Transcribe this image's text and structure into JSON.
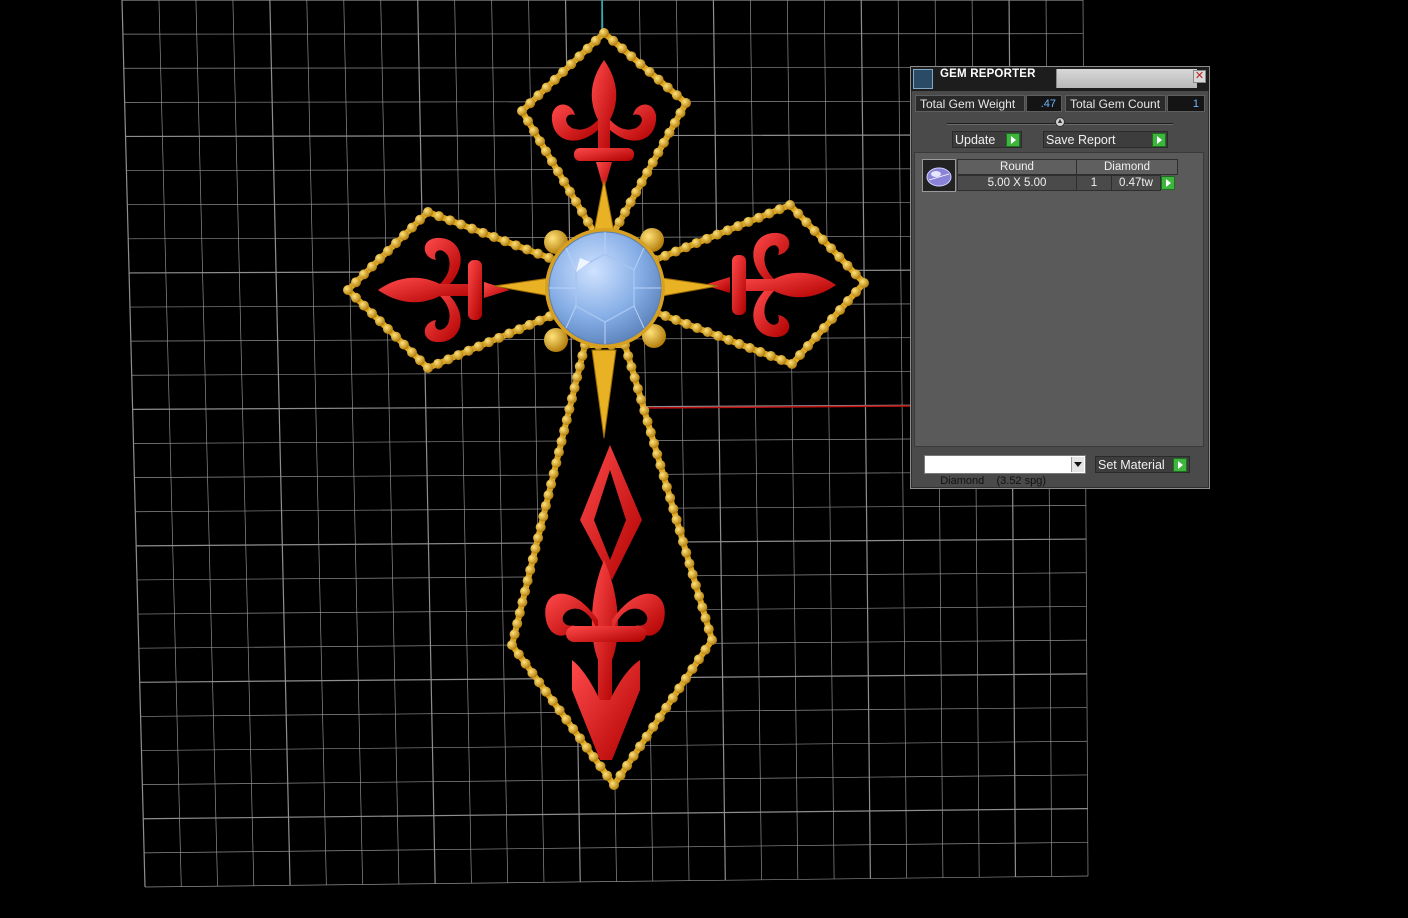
{
  "window": {
    "title": "GEM REPORTER",
    "close_glyph": "✕"
  },
  "stats": {
    "weight_label": "Total Gem Weight",
    "weight_value": ".47",
    "count_label": "Total Gem Count",
    "count_value": "1"
  },
  "actions": {
    "update_label": "Update",
    "save_report_label": "Save Report",
    "set_material_label": "Set Material"
  },
  "gem_table": {
    "rows": [
      {
        "thumbnail_icon": "round-gem-icon",
        "shape": "Round",
        "material": "Diamond",
        "size": "5.00 X 5.00",
        "count": "1",
        "weight": "0.47tw"
      }
    ]
  },
  "material_select": {
    "selected": "Diamond    (3.52 spg)"
  },
  "colors": {
    "gold": "#e0a81e",
    "enamel_red": "#e00808",
    "stone_blue": "#86aee6",
    "grid": "#a8a8a8",
    "panel_bg": "#4a4a4a",
    "value_text": "#6fb6ff",
    "go_green": "#3eb53e"
  }
}
